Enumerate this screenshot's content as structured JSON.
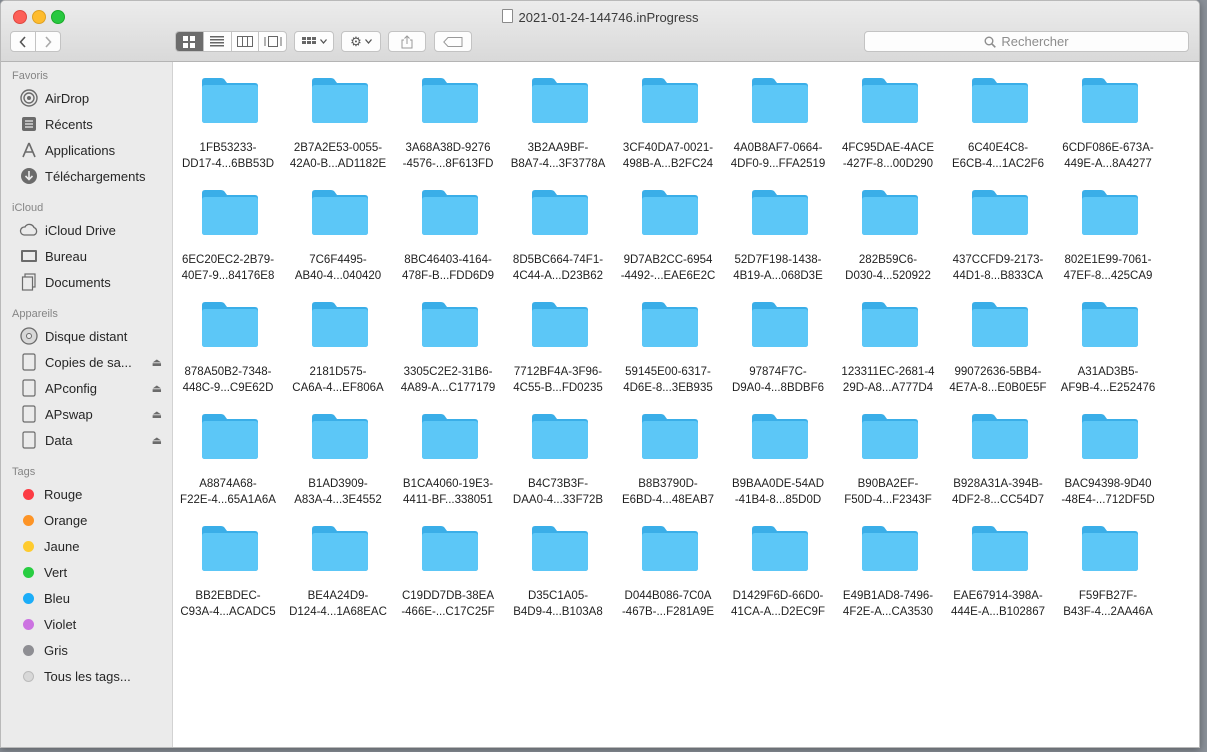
{
  "window": {
    "title": "2021-01-24-144746.inProgress"
  },
  "toolbar": {
    "back_icon": "chevron-left-icon",
    "forward_icon": "chevron-right-icon",
    "search_placeholder": "Rechercher"
  },
  "sidebar": {
    "favoris_header": "Favoris",
    "favoris": [
      {
        "label": "AirDrop",
        "icon": "airdrop-icon"
      },
      {
        "label": "Récents",
        "icon": "recents-icon"
      },
      {
        "label": "Applications",
        "icon": "applications-icon"
      },
      {
        "label": "Téléchargements",
        "icon": "downloads-icon"
      }
    ],
    "icloud_header": "iCloud",
    "icloud": [
      {
        "label": "iCloud Drive",
        "icon": "cloud-icon"
      },
      {
        "label": "Bureau",
        "icon": "desktop-icon"
      },
      {
        "label": "Documents",
        "icon": "document-icon"
      }
    ],
    "appareils_header": "Appareils",
    "appareils": [
      {
        "label": "Disque distant",
        "icon": "disc-icon"
      },
      {
        "label": "Copies de sa...",
        "icon": "drive-icon"
      },
      {
        "label": "APconfig",
        "icon": "drive-icon"
      },
      {
        "label": "APswap",
        "icon": "drive-icon"
      },
      {
        "label": "Data",
        "icon": "drive-icon"
      }
    ],
    "tags_header": "Tags",
    "tags": [
      {
        "label": "Rouge",
        "color": "#fc3c44"
      },
      {
        "label": "Orange",
        "color": "#fd9426"
      },
      {
        "label": "Jaune",
        "color": "#fecb2f"
      },
      {
        "label": "Vert",
        "color": "#28cd41"
      },
      {
        "label": "Bleu",
        "color": "#1badf8"
      },
      {
        "label": "Violet",
        "color": "#cc73e1"
      },
      {
        "label": "Gris",
        "color": "#8e8e93"
      },
      {
        "label": "Tous les tags...",
        "color": ""
      }
    ]
  },
  "folders": [
    [
      "1FB53233-",
      "DD17-4...6BB53D"
    ],
    [
      "2B7A2E53-0055-",
      "42A0-B...AD1182E"
    ],
    [
      "3A68A38D-9276",
      "-4576-...8F613FD"
    ],
    [
      "3B2AA9BF-",
      "B8A7-4...3F3778A"
    ],
    [
      "3CF40DA7-0021-",
      "498B-A...B2FC24"
    ],
    [
      "4A0B8AF7-0664-",
      "4DF0-9...FFA2519"
    ],
    [
      "4FC95DAE-4ACE",
      "-427F-8...00D290"
    ],
    [
      "6C40E4C8-",
      "E6CB-4...1AC2F6"
    ],
    [
      "6CDF086E-673A-",
      "449E-A...8A4277"
    ],
    [
      "6EC20EC2-2B79-",
      "40E7-9...84176E8"
    ],
    [
      "7C6F4495-",
      "AB40-4...040420"
    ],
    [
      "8BC46403-4164-",
      "478F-B...FDD6D9"
    ],
    [
      "8D5BC664-74F1-",
      "4C44-A...D23B62"
    ],
    [
      "9D7AB2CC-6954",
      "-4492-...EAE6E2C"
    ],
    [
      "52D7F198-1438-",
      "4B19-A...068D3E"
    ],
    [
      "282B59C6-",
      "D030-4...520922"
    ],
    [
      "437CCFD9-2173-",
      "44D1-8...B833CA"
    ],
    [
      "802E1E99-7061-",
      "47EF-8...425CA9"
    ],
    [
      "878A50B2-7348-",
      "448C-9...C9E62D"
    ],
    [
      "2181D575-",
      "CA6A-4...EF806A"
    ],
    [
      "3305C2E2-31B6-",
      "4A89-A...C177179"
    ],
    [
      "7712BF4A-3F96-",
      "4C55-B...FD0235"
    ],
    [
      "59145E00-6317-",
      "4D6E-8...3EB935"
    ],
    [
      "97874F7C-",
      "D9A0-4...8BDBF6"
    ],
    [
      "123311EC-2681-4",
      "29D-A8...A777D4"
    ],
    [
      "99072636-5BB4-",
      "4E7A-8...E0B0E5F"
    ],
    [
      "A31AD3B5-",
      "AF9B-4...E252476"
    ],
    [
      "A8874A68-",
      "F22E-4...65A1A6A"
    ],
    [
      "B1AD3909-",
      "A83A-4...3E4552"
    ],
    [
      "B1CA4060-19E3-",
      "4411-BF...338051"
    ],
    [
      "B4C73B3F-",
      "DAA0-4...33F72B"
    ],
    [
      "B8B3790D-",
      "E6BD-4...48EAB7"
    ],
    [
      "B9BAA0DE-54AD",
      "-41B4-8...85D0D"
    ],
    [
      "B90BA2EF-",
      "F50D-4...F2343F"
    ],
    [
      "B928A31A-394B-",
      "4DF2-8...CC54D7"
    ],
    [
      "BAC94398-9D40",
      "-48E4-...712DF5D"
    ],
    [
      "BB2EBDEC-",
      "C93A-4...ACADC5"
    ],
    [
      "BE4A24D9-",
      "D124-4...1A68EAC"
    ],
    [
      "C19DD7DB-38EA",
      "-466E-...C17C25F"
    ],
    [
      "D35C1A05-",
      "B4D9-4...B103A8"
    ],
    [
      "D044B086-7C0A",
      "-467B-...F281A9E"
    ],
    [
      "D1429F6D-66D0-",
      "41CA-A...D2EC9F"
    ],
    [
      "E49B1AD8-7496-",
      "4F2E-A...CA3530"
    ],
    [
      "EAE67914-398A-",
      "444E-A...B102867"
    ],
    [
      "F59FB27F-",
      "B43F-4...2AA46A"
    ]
  ]
}
